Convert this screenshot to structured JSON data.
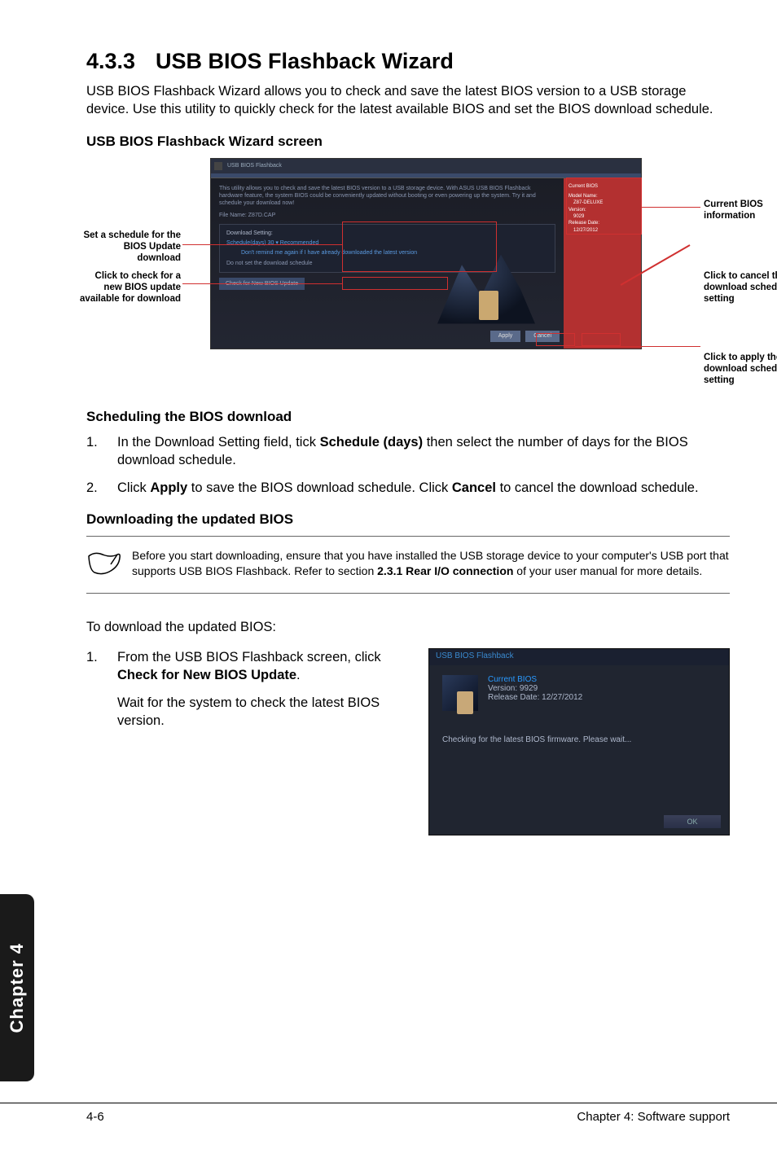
{
  "section": {
    "number": "4.3.3",
    "title": "USB BIOS Flashback Wizard"
  },
  "intro": "USB BIOS Flashback Wizard allows you to check and save the latest BIOS version to a USB storage device. Use this utility to quickly check for the latest available BIOS and set the BIOS download schedule.",
  "screen_heading": "USB BIOS Flashback Wizard screen",
  "callouts": {
    "left1": "Set a schedule for the BIOS Update download",
    "left2": "Click to check for a new BIOS update available for download",
    "right1": "Current BIOS information",
    "right2": "Click to cancel the download schedule setting",
    "right3": "Click to apply the download schedule setting"
  },
  "shot1": {
    "window_title": "USB BIOS Flashback",
    "desc": "This utility allows you to check and save the latest BIOS version to a USB storage device. With ASUS USB BIOS Flashback hardware feature, the system BIOS could be conveniently updated without booting or even powering up the system. Try it and schedule your download now!",
    "file_label": "File Name: Z87D.CAP",
    "panel_title": "Download Setting:",
    "schedule_line": "Schedule(days)     30   ▾    Recommended",
    "schedule_note": "Don't remind me again if I have already downloaded the latest version",
    "checkbox": "Do not set the download schedule",
    "check_btn": "Check for New BIOS Update",
    "apply": "Apply",
    "cancel": "Cancel",
    "side_title": "Current BIOS",
    "side_model": "Model Name:",
    "side_model_v": "Z87-DELUXE",
    "side_ver": "Version:",
    "side_ver_v": "9029",
    "side_date": "Release Date:",
    "side_date_v": "12/27/2012"
  },
  "sched_heading": "Scheduling the BIOS download",
  "sched_steps": [
    {
      "n": "1.",
      "pre": "In the Download Setting field, tick ",
      "bold": "Schedule (days)",
      "post": " then select the number of days for the BIOS download schedule."
    },
    {
      "n": "2.",
      "pre": "Click ",
      "bold": "Apply",
      "mid": " to save the BIOS download schedule. Click ",
      "bold2": "Cancel",
      "post": " to cancel the download schedule."
    }
  ],
  "dl_heading": "Downloading the updated BIOS",
  "note": {
    "line1": "Before you start downloading, ensure that you have installed the USB storage device to your computer's USB port that supports USB BIOS Flashback. Refer to section ",
    "bold": "2.3.1 Rear I/O connection",
    "line2": " of your user manual for more details."
  },
  "dl_intro": "To download the updated BIOS:",
  "dl_step": {
    "n": "1.",
    "pre": "From the USB BIOS Flashback screen, click ",
    "bold": "Check for New BIOS Update",
    "post": ".",
    "wait": "Wait for the system to check the latest BIOS version."
  },
  "shot2": {
    "title": "USB BIOS Flashback",
    "current": "Current BIOS",
    "version": "Version:  9929",
    "date": "Release Date:  12/27/2012",
    "checking": "Checking for the latest BIOS firmware. Please wait...",
    "ok": "OK"
  },
  "tab": "Chapter 4",
  "footer_left": "4-6",
  "footer_right": "Chapter 4: Software support"
}
